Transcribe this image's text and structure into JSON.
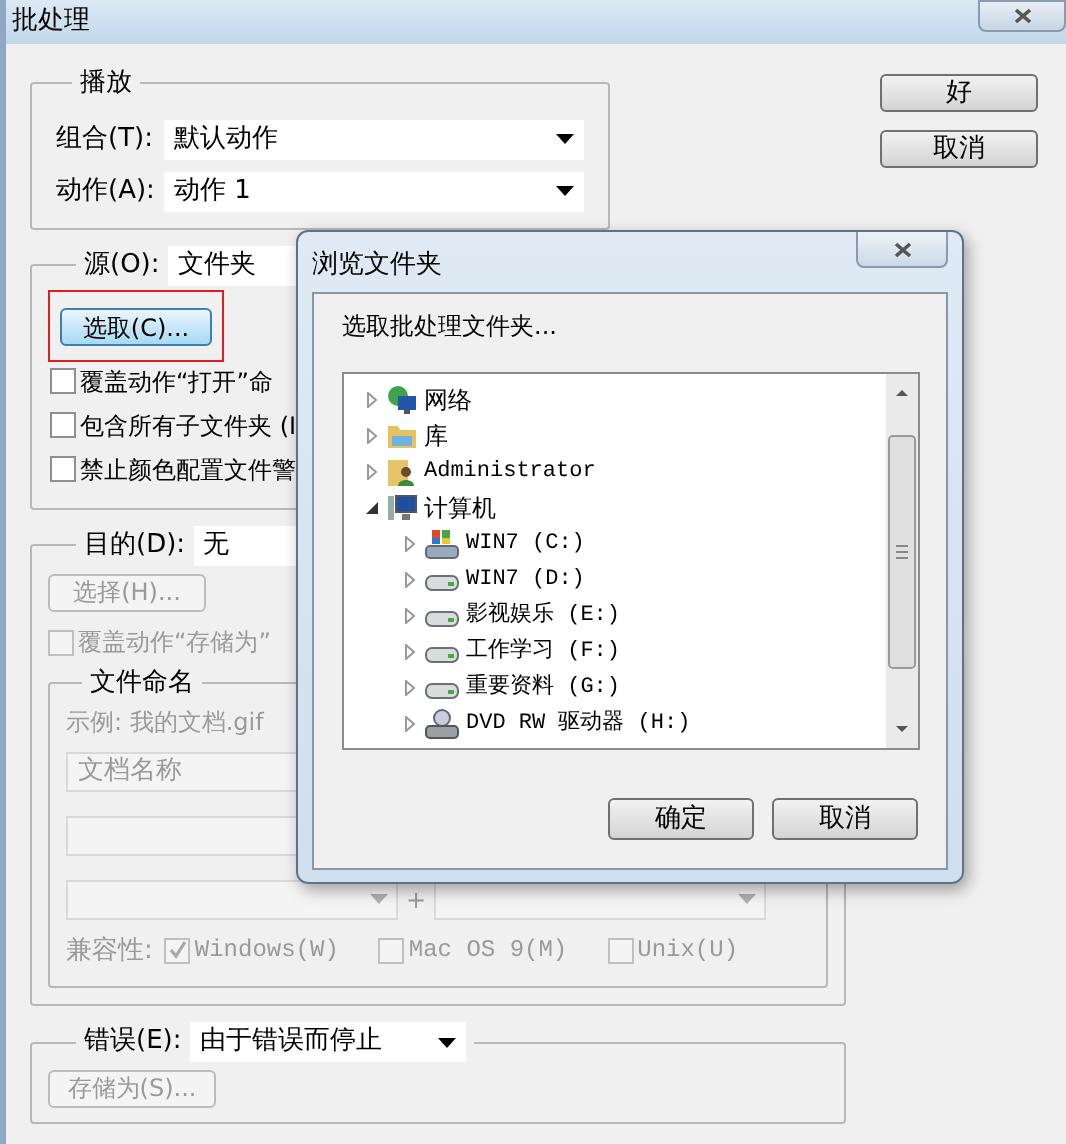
{
  "window": {
    "title": "批处理"
  },
  "buttons": [
    {
      "label": "好"
    },
    {
      "label": "取消"
    }
  ],
  "play": {
    "title": "播放",
    "fields": [
      {
        "label": "组合(T):",
        "value": "默认动作"
      },
      {
        "label": "动作(A):",
        "value": "动作 1"
      }
    ]
  },
  "source": {
    "label": "源(O):",
    "value": "文件夹",
    "choose_button": {
      "label": "选取(C)...",
      "highlighted": true
    },
    "options": [
      {
        "label": "覆盖动作“打开”命",
        "checked": false
      },
      {
        "label": "包含所有子文件夹 (I",
        "checked": false
      },
      {
        "label": "禁止颜色配置文件警",
        "checked": false
      }
    ]
  },
  "destination": {
    "label": "目的(D):",
    "value": "无",
    "choose_button": {
      "label": "选择(H)...",
      "disabled": true
    },
    "override": {
      "label": "覆盖动作“存储为”",
      "checked": false,
      "disabled": true
    },
    "file_naming": {
      "title": "文件命名",
      "disabled": true,
      "example": "示例: 我的文档.gif",
      "first_field": "文档名称",
      "plus": "+",
      "compatibility_label": "兼容性:",
      "compatibility": [
        {
          "label": "Windows(W)",
          "checked": true
        },
        {
          "label": "Mac OS 9(M)",
          "checked": false
        },
        {
          "label": "Unix(U)",
          "checked": false
        }
      ]
    }
  },
  "errors": {
    "label": "错误(E):",
    "value": "由于错误而停止",
    "save_button": {
      "label": "存储为(S)...",
      "disabled": true
    }
  },
  "browse_dialog": {
    "title": "浏览文件夹",
    "prompt": "选取批处理文件夹...",
    "tree": [
      {
        "label": "网络",
        "kind": "network",
        "expanded": false
      },
      {
        "label": "库",
        "kind": "library",
        "expanded": false
      },
      {
        "label": "Administrator",
        "kind": "user",
        "expanded": false
      },
      {
        "label": "计算机",
        "kind": "computer",
        "expanded": true,
        "children": [
          {
            "label": "WIN7 (C:)",
            "kind": "system-drive",
            "expanded": false
          },
          {
            "label": "WIN7 (D:)",
            "kind": "drive",
            "expanded": false
          },
          {
            "label": "影视娱乐 (E:)",
            "kind": "drive",
            "expanded": false
          },
          {
            "label": "工作学习 (F:)",
            "kind": "drive",
            "expanded": false
          },
          {
            "label": "重要资料 (G:)",
            "kind": "drive",
            "expanded": false
          },
          {
            "label": "DVD RW 驱动器 (H:)",
            "kind": "dvd",
            "expanded": false
          }
        ]
      }
    ],
    "buttons": [
      {
        "label": "确定"
      },
      {
        "label": "取消"
      }
    ]
  }
}
